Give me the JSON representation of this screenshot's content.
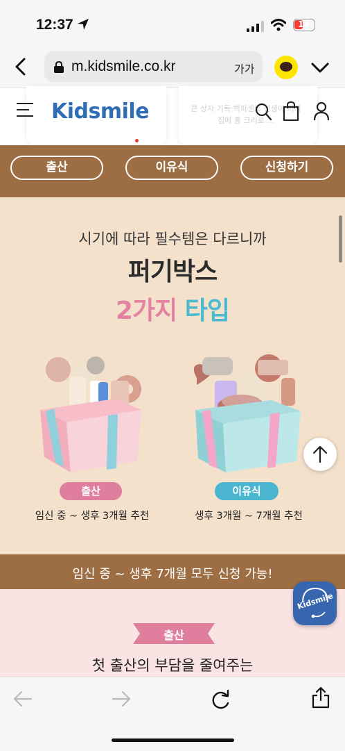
{
  "status_bar": {
    "time": "12:37",
    "battery": "14"
  },
  "browser": {
    "url": "m.kidsmile.co.kr",
    "text_size_label": "가가"
  },
  "site": {
    "logo": "Kidsmile",
    "peek_text": "큰 상자 가득 백퍼센트 신생아 퍼기 집에 흥 크리로 ..."
  },
  "nav": {
    "items": [
      "출산",
      "이유식",
      "신청하기"
    ]
  },
  "hero": {
    "subtitle": "시기에 따라 필수템은 다르니까",
    "title": "퍼기박스",
    "title2_part1": "2가지",
    "title2_part2": "타입",
    "types": [
      {
        "tag": "출산",
        "desc": "임신 중 ~ 생후 3개월 추천",
        "color": "#e07e9e"
      },
      {
        "tag": "이유식",
        "desc": "생후 3개월 ~ 7개월 추천",
        "color": "#4ab6cf"
      }
    ]
  },
  "banner": {
    "text": "임신 중 ~ 생후 7개월 모두 신청 가능!"
  },
  "birth_section": {
    "ribbon": "출산",
    "heading": "첫 출산의 부담을 줄여주는"
  },
  "chat_fab": {
    "label": "Kidsmile"
  },
  "colors": {
    "brown": "#9d6d43",
    "cream": "#f3e1cb",
    "pink": "#e07e9e",
    "teal": "#4ab6cf",
    "logo_blue": "#2f6db5"
  }
}
